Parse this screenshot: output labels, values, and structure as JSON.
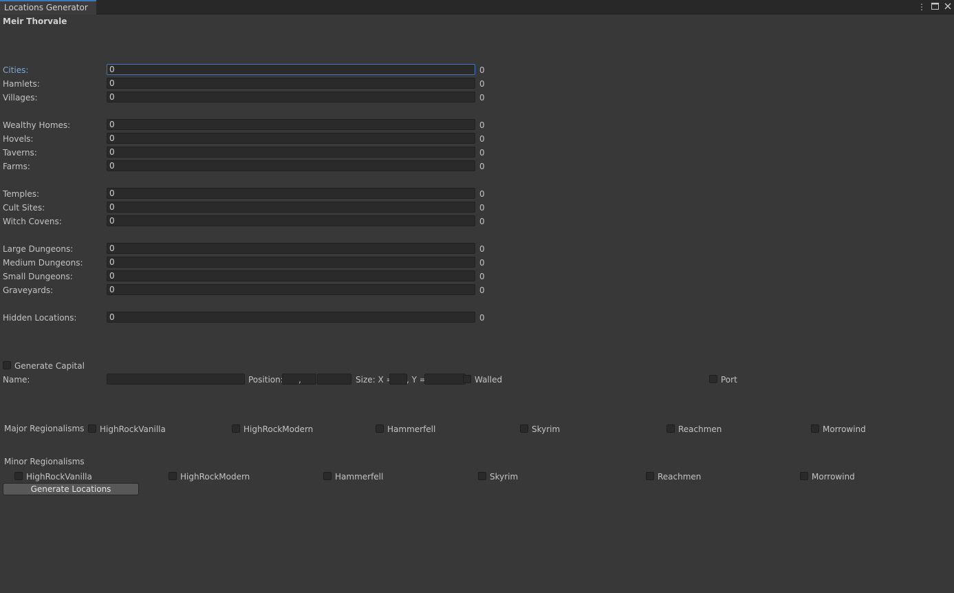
{
  "window": {
    "tab_title": "Locations Generator",
    "menu_icon": "kebab-menu-icon",
    "maximize_icon": "maximize-icon",
    "close_icon": "close-icon"
  },
  "region_name": "Meir Thorvale",
  "fields": {
    "cities": {
      "label": "Cities:",
      "value": "0",
      "count": "0"
    },
    "hamlets": {
      "label": "Hamlets:",
      "value": "0",
      "count": "0"
    },
    "villages": {
      "label": "Villages:",
      "value": "0",
      "count": "0"
    },
    "wealthy_homes": {
      "label": "Wealthy Homes:",
      "value": "0",
      "count": "0"
    },
    "hovels": {
      "label": "Hovels:",
      "value": "0",
      "count": "0"
    },
    "taverns": {
      "label": "Taverns:",
      "value": "0",
      "count": "0"
    },
    "farms": {
      "label": "Farms:",
      "value": "0",
      "count": "0"
    },
    "temples": {
      "label": "Temples:",
      "value": "0",
      "count": "0"
    },
    "cult_sites": {
      "label": "Cult Sites:",
      "value": "0",
      "count": "0"
    },
    "witch_covens": {
      "label": "Witch Covens:",
      "value": "0",
      "count": "0"
    },
    "large_dungeons": {
      "label": "Large Dungeons:",
      "value": "0",
      "count": "0"
    },
    "medium_dungeons": {
      "label": "Medium Dungeons:",
      "value": "0",
      "count": "0"
    },
    "small_dungeons": {
      "label": "Small Dungeons:",
      "value": "0",
      "count": "0"
    },
    "graveyards": {
      "label": "Graveyards:",
      "value": "0",
      "count": "0"
    },
    "hidden_locations": {
      "label": "Hidden Locations:",
      "value": "0",
      "count": "0"
    }
  },
  "capital": {
    "generate_label": "Generate Capital",
    "name_label": "Name:",
    "name_value": "",
    "position_label": "Position:",
    "position_separator": ",",
    "size_x_label": "Size: X =",
    "size_y_label": ", Y =",
    "walled_label": "Walled",
    "port_label": "Port"
  },
  "major_regionalisms": {
    "label": "Major Regionalisms",
    "options": [
      "HighRockVanilla",
      "HighRockModern",
      "Hammerfell",
      "Skyrim",
      "Reachmen",
      "Morrowind"
    ]
  },
  "minor_regionalisms": {
    "label": "Minor Regionalisms",
    "options": [
      "HighRockVanilla",
      "HighRockModern",
      "Hammerfell",
      "Skyrim",
      "Reachmen",
      "Morrowind"
    ]
  },
  "generate_button": "Generate Locations",
  "colors": {
    "background": "#383838",
    "field": "#2a2a2a",
    "accent": "#3a79bb",
    "active_label": "#7cabe0"
  }
}
